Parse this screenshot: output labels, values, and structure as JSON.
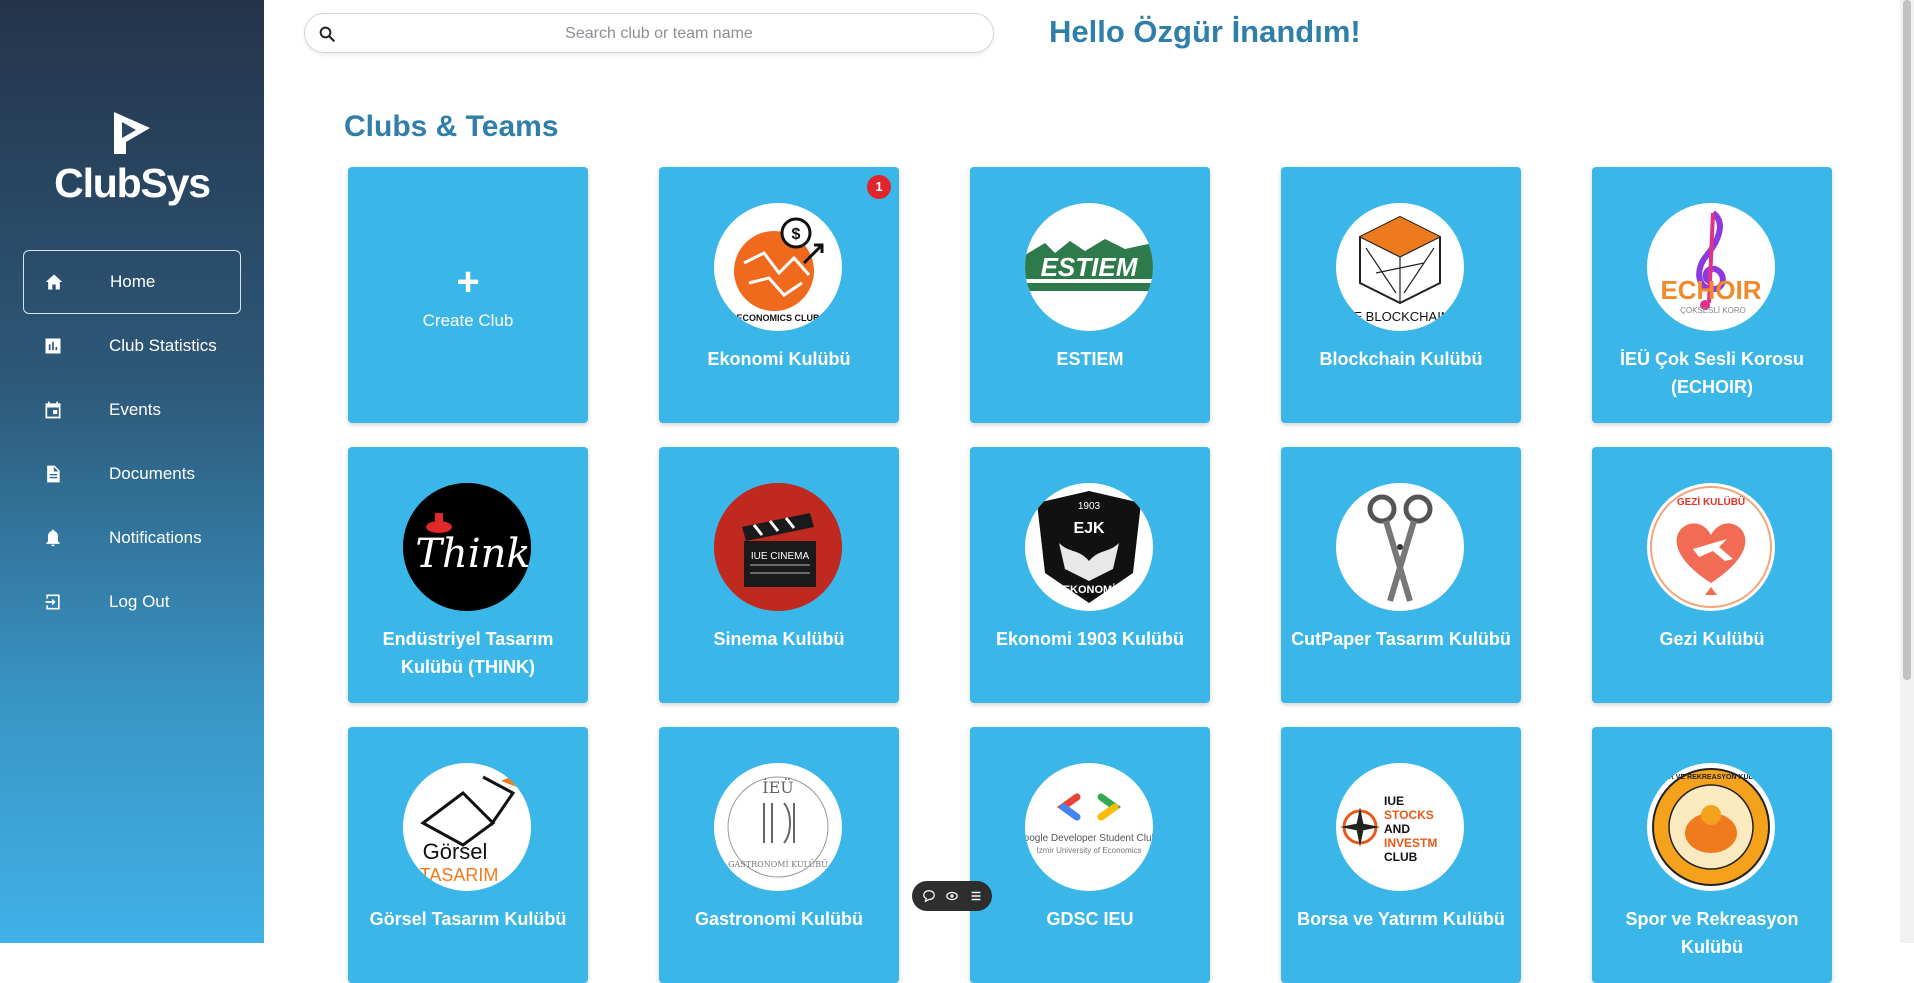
{
  "sidebar": {
    "brand": "ClubSys",
    "nav": [
      {
        "label": "Home",
        "icon": "home-icon",
        "active": true
      },
      {
        "label": "Club Statistics",
        "icon": "bar-chart-icon"
      },
      {
        "label": "Events",
        "icon": "calendar-icon"
      },
      {
        "label": "Documents",
        "icon": "document-icon"
      },
      {
        "label": "Notifications",
        "icon": "bell-icon"
      },
      {
        "label": "Log Out",
        "icon": "logout-icon"
      }
    ]
  },
  "header": {
    "search_placeholder": "Search club or team name",
    "greeting": "Hello Özgür İnandım!"
  },
  "main": {
    "section_title": "Clubs & Teams",
    "create_plus": "+",
    "create_label": "Create Club",
    "clubs": [
      {
        "name": "Ekonomi Kulübü",
        "badge": "1"
      },
      {
        "name": "ESTIEM"
      },
      {
        "name": "Blockchain Kulübü"
      },
      {
        "name": "İEÜ Çok Sesli Korosu (ECHOIR)"
      },
      {
        "name": "Endüstriyel Tasarım Kulübü (THINK)"
      },
      {
        "name": "Sinema Kulübü"
      },
      {
        "name": "Ekonomi 1903 Kulübü"
      },
      {
        "name": "CutPaper Tasarım Kulübü"
      },
      {
        "name": "Gezi Kulübü"
      },
      {
        "name": "Görsel Tasarım Kulübü"
      },
      {
        "name": "Gastronomi Kulübü"
      },
      {
        "name": "GDSC IEU"
      },
      {
        "name": "Borsa ve Yatırım Kulübü"
      },
      {
        "name": "Spor ve Rekreasyon Kulübü"
      }
    ]
  },
  "logo_text": {
    "economics": "ECONOMICS CLUB",
    "estiem": "ESTIEM",
    "blockchain": "IE BLOCKCHAIN",
    "echoir": "ECHOIR",
    "echoir_sub": "ÇOKSESLİ KORO",
    "think": "Think",
    "cinema": "IUE CINEMA",
    "ekonomi_year": "1903",
    "ekonomi_mono": "EJK",
    "ekonomi_word": "EKONOMİ",
    "gezi": "GEZİ KULÜBÜ",
    "gorsel1": "Görsel",
    "gorsel2": "TASARIM",
    "gastro_top": "İEÜ",
    "gastro_ring": "GASTRONOMİ KULÜBÜ",
    "gdsc1": "Google Developer Student Clubs",
    "gdsc2": "Izmir University of Economics",
    "stocks1": "IUE",
    "stocks2": "STOCKS",
    "stocks3": "AND",
    "stocks4": "INVESTM",
    "stocks5": "CLUB",
    "spor": "SPOR VE REKREASYON KULÜBÜ"
  },
  "colors": {
    "card": "#3bb6e8",
    "title": "#2f7fa9",
    "badge": "#e0252d"
  }
}
